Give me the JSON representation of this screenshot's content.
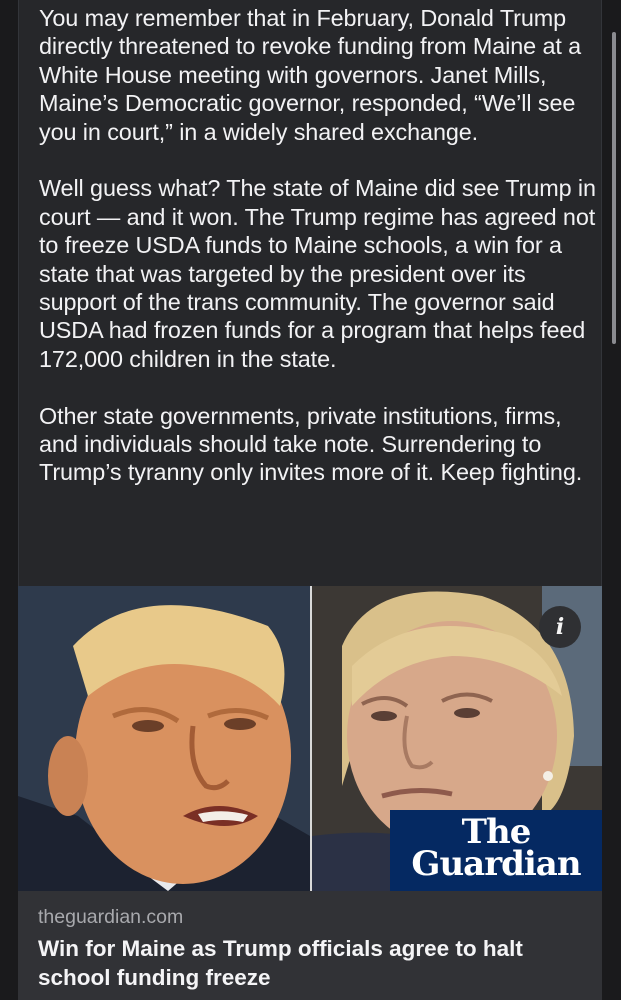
{
  "post": {
    "paragraphs": [
      "You may remember that in February, Donald Trump directly threatened to revoke funding from Maine at a White House meeting with governors. Janet Mills, Maine’s Democratic governor, responded, “We’ll see you in court,” in a widely shared exchange.",
      "Well guess what? The state of Maine did see Trump in court — and it won. The Trump regime has agreed not to freeze USDA funds to Maine schools, a win for a state that was targeted by the president over its support of the trans community. The governor said USDA had frozen funds for a program that helps feed 172,000 children in the state.",
      "Other state governments, private institutions, firms, and individuals should take note. Surrendering to Trump’s tyranny only invites more of it. Keep fighting."
    ]
  },
  "link_preview": {
    "domain": "theguardian.com",
    "headline": "Win for Maine as Trump officials agree to halt school funding freeze",
    "info_glyph": "i",
    "brand": {
      "line1": "The",
      "line2": "Guardian",
      "color": "#052962"
    }
  },
  "colors": {
    "page_bg": "#1a1a1c",
    "card_bg": "#26272a",
    "link_card_bg": "#313236",
    "text": "#f2f2f4",
    "muted_text": "#a8a9ad"
  }
}
